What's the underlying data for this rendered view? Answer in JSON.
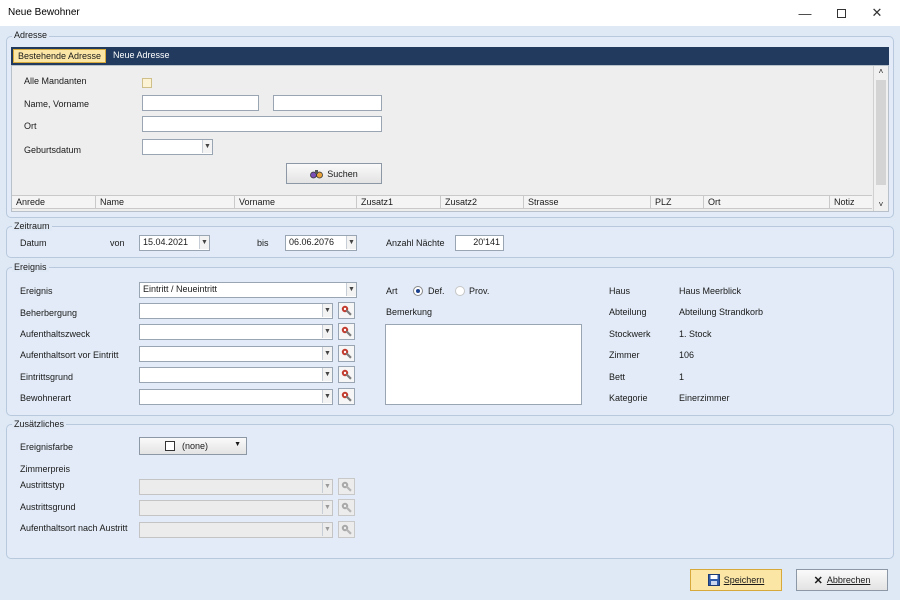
{
  "window": {
    "title": "Neue Bewohner"
  },
  "adresse": {
    "group_label": "Adresse",
    "tabs": [
      {
        "label": "Bestehende Adresse",
        "active": true
      },
      {
        "label": "Neue Adresse",
        "active": false
      }
    ],
    "alle_mandanten_label": "Alle Mandanten",
    "name_label": "Name, Vorname",
    "ort_label": "Ort",
    "geburtsdatum_label": "Geburtsdatum",
    "suchen_label": "Suchen",
    "columns": [
      "Anrede",
      "Name",
      "Vorname",
      "Zusatz1",
      "Zusatz2",
      "Strasse",
      "PLZ",
      "Ort",
      "Notiz"
    ]
  },
  "zeitraum": {
    "group_label": "Zeitraum",
    "datum_label": "Datum",
    "von_label": "von",
    "von_value": "15.04.2021",
    "bis_label": "bis",
    "bis_value": "06.06.2076",
    "naechte_label": "Anzahl Nächte",
    "naechte_value": "20'141"
  },
  "ereignis": {
    "group_label": "Ereignis",
    "ereignis_label": "Ereignis",
    "ereignis_value": "Eintritt / Neueintritt",
    "beherbergung_label": "Beherbergung",
    "aufenthaltszweck_label": "Aufenthaltszweck",
    "aufenthaltsort_label": "Aufenthaltsort vor Eintritt",
    "eintrittsgrund_label": "Eintrittsgrund",
    "bewohnerart_label": "Bewohnerart",
    "art_label": "Art",
    "art_def": "Def.",
    "art_prov": "Prov.",
    "bemerkung_label": "Bemerkung",
    "info": [
      {
        "label": "Haus",
        "value": "Haus Meerblick"
      },
      {
        "label": "Abteilung",
        "value": "Abteilung Strandkorb"
      },
      {
        "label": "Stockwerk",
        "value": "1. Stock"
      },
      {
        "label": "Zimmer",
        "value": "106"
      },
      {
        "label": "Bett",
        "value": "1"
      },
      {
        "label": "Kategorie",
        "value": "Einerzimmer"
      }
    ]
  },
  "zusaetzliches": {
    "group_label": "Zusätzliches",
    "ereignisfarbe_label": "Ereignisfarbe",
    "ereignisfarbe_value": "(none)",
    "zimmerpreis_label": "Zimmerpreis",
    "austrittstyp_label": "Austrittstyp",
    "austrittsgrund_label": "Austrittsgrund",
    "aufenthaltsort_nach_label": "Aufenthaltsort nach Austritt"
  },
  "footer": {
    "save_label": "Speichern",
    "cancel_label": "Abbrechen"
  },
  "colors": {
    "save_button_bg": "#fbe6a6",
    "tab_strip": "#223a5e",
    "window_bg": "#dfe9f5"
  },
  "icons": {
    "save": "floppy-disk-icon",
    "cancel": "x-mark-icon",
    "search": "binoculars-icon",
    "picker": "wrench-icon"
  }
}
